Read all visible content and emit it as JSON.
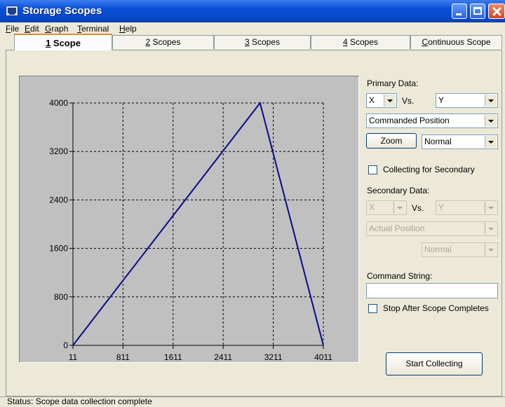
{
  "window": {
    "title": "Storage Scopes"
  },
  "menu": {
    "items": [
      {
        "mnemonic": "F",
        "rest": "ile"
      },
      {
        "mnemonic": "E",
        "rest": "dit"
      },
      {
        "mnemonic": "G",
        "rest": "raph"
      },
      {
        "mnemonic": "T",
        "rest": "erminal"
      },
      {
        "mnemonic": "H",
        "rest": "elp"
      }
    ]
  },
  "tabs": [
    {
      "mnemonic": "1",
      "rest": " Scope",
      "active": true
    },
    {
      "mnemonic": "2",
      "rest": " Scopes",
      "active": false
    },
    {
      "mnemonic": "3",
      "rest": " Scopes",
      "active": false
    },
    {
      "mnemonic": "4",
      "rest": " Scopes",
      "active": false
    },
    {
      "mnemonic": "C",
      "rest": "ontinuous Scope",
      "active": false
    }
  ],
  "primary": {
    "label": "Primary Data:",
    "x_axis": "X",
    "vs_label": "Vs.",
    "y_axis": "Y",
    "signal": "Commanded Position",
    "zoom_button": "Zoom",
    "zoom_mode": "Normal"
  },
  "collecting_secondary": {
    "label": "Collecting for Secondary",
    "checked": false
  },
  "secondary": {
    "label": "Secondary Data:",
    "x_axis": "X",
    "vs_label": "Vs.",
    "y_axis": "Y",
    "signal": "Actual Position",
    "zoom_mode": "Normal"
  },
  "command": {
    "label": "Command String:",
    "value": ""
  },
  "stop_after": {
    "label": "Stop After Scope Completes",
    "checked": false
  },
  "start_button": "Start Collecting",
  "status": "Status: Scope data collection complete",
  "colors": {
    "plot_background": "#c0c0c0",
    "series_line": "#0a0a8a",
    "gridline": "#000000"
  },
  "chart_data": {
    "type": "line",
    "x_ticks": [
      "11",
      "811",
      "1611",
      "2411",
      "3211",
      "4011"
    ],
    "y_ticks": [
      "0",
      "800",
      "1600",
      "2400",
      "3200",
      "4000"
    ],
    "xlim": [
      11,
      4011
    ],
    "ylim": [
      0,
      4000
    ],
    "grid": true,
    "series": [
      {
        "x": [
          11,
          3000,
          4011
        ],
        "y": [
          0,
          4000,
          0
        ]
      }
    ]
  }
}
